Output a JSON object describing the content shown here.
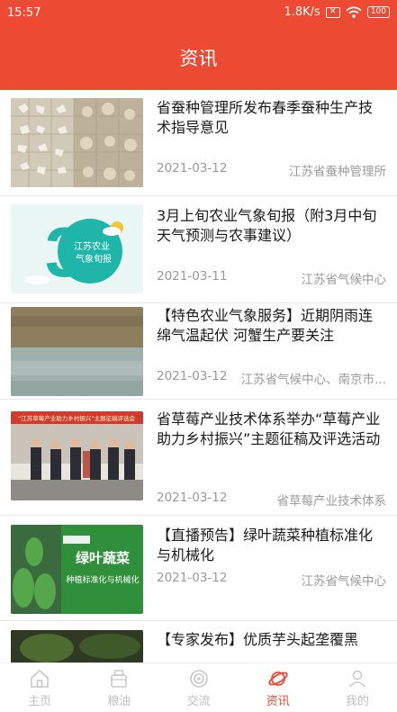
{
  "status": {
    "time": "15:57",
    "speed": "1.8K/s",
    "battery": "100"
  },
  "header": {
    "title": "资讯"
  },
  "articles": [
    {
      "title": "省蚕种管理所发布春季蚕种生产技术指导意见",
      "date": "2021-03-12",
      "source": "江苏省蚕种管理所",
      "thumb": "silkworm-eggs-image"
    },
    {
      "title": "3月上旬农业气象旬报（附3月中旬天气预测与农事建议）",
      "date": "2021-03-11",
      "source": "江苏省气候中心",
      "thumb": "weather-report-image",
      "thumb_text": [
        "江苏农业",
        "气象旬报"
      ],
      "thumb_number": "3"
    },
    {
      "title": "【特色农业气象服务】近期阴雨连绵气温起伏 河蟹生产要关注",
      "date": "2021-03-12",
      "source": "江苏省气候中心、南京市...",
      "thumb": "crab-pond-image"
    },
    {
      "title": "省草莓产业技术体系举办“草莓产业助力乡村振兴”主题征稿及评选活动",
      "date": "2021-03-12",
      "source": "省草莓产业技术体系",
      "thumb": "meeting-photo-image",
      "thumb_text": [
        "“江苏草莓产业助力乡村振兴”主题征稿评选会"
      ]
    },
    {
      "title": "【直播预告】绿叶蔬菜种植标准化与机械化",
      "date": "2021-03-12",
      "source": "江苏省气候中心",
      "thumb": "vegetable-live-image",
      "thumb_text": [
        "绿叶蔬菜",
        "种植标准化与机械化"
      ]
    },
    {
      "title": "【专家发布】优质芋头起垄覆黑",
      "date": "",
      "source": "",
      "thumb": "taro-image"
    }
  ],
  "tabs": [
    {
      "label": "主页",
      "icon": "home-icon",
      "active": false
    },
    {
      "label": "粮油",
      "icon": "grain-icon",
      "active": false
    },
    {
      "label": "交流",
      "icon": "exchange-icon",
      "active": false
    },
    {
      "label": "资讯",
      "icon": "news-planet-icon",
      "active": true
    },
    {
      "label": "我的",
      "icon": "profile-icon",
      "active": false
    }
  ],
  "colors": {
    "brand": "#ec4a32",
    "inactive": "#c0c0c0",
    "meta": "#9a9a9a"
  }
}
